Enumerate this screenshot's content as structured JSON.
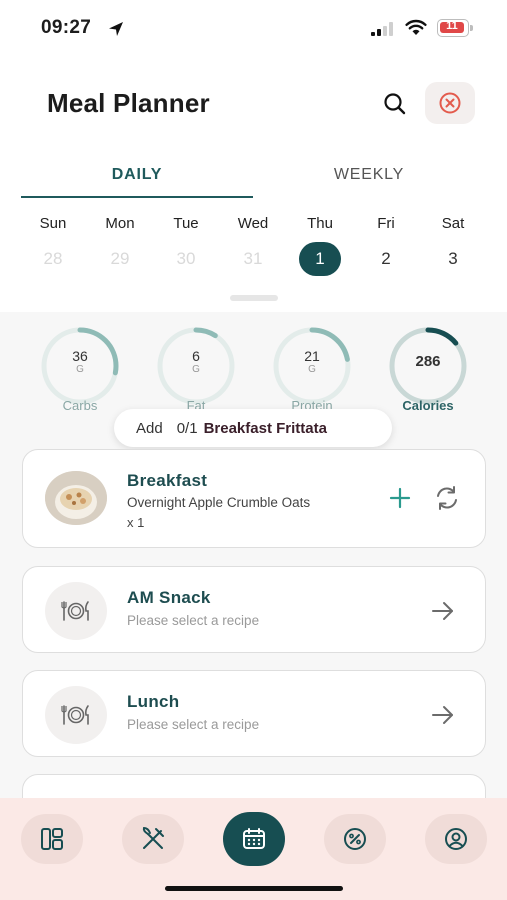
{
  "status_bar": {
    "time": "09:27",
    "battery": "11"
  },
  "header": {
    "title": "Meal Planner"
  },
  "tabs": [
    {
      "label": "DAILY",
      "active": true
    },
    {
      "label": "WEEKLY",
      "active": false
    }
  ],
  "week": [
    {
      "day": "Sun",
      "date": "28",
      "state": "past"
    },
    {
      "day": "Mon",
      "date": "29",
      "state": "past"
    },
    {
      "day": "Tue",
      "date": "30",
      "state": "past"
    },
    {
      "day": "Wed",
      "date": "31",
      "state": "past"
    },
    {
      "day": "Thu",
      "date": "1",
      "state": "selected"
    },
    {
      "day": "Fri",
      "date": "2",
      "state": "future"
    },
    {
      "day": "Sat",
      "date": "3",
      "state": "future"
    }
  ],
  "nutrition": [
    {
      "value": "36",
      "unit": "G",
      "label": "Carbs",
      "progress": 0.28
    },
    {
      "value": "6",
      "unit": "G",
      "label": "Fat",
      "progress": 0.09
    },
    {
      "value": "21",
      "unit": "G",
      "label": "Protein",
      "progress": 0.22
    },
    {
      "value": "286",
      "unit": "",
      "label": "Calories",
      "progress": 0.14
    }
  ],
  "add_pill": {
    "add": "Add",
    "count": "0/1",
    "recipe": "Breakfast Frittata"
  },
  "meals": [
    {
      "name": "Breakfast",
      "recipe": "Overnight Apple Crumble Oats",
      "qty": "x 1"
    },
    {
      "name": "AM Snack",
      "hint": "Please select a recipe"
    },
    {
      "name": "Lunch",
      "hint": "Please select a recipe"
    }
  ],
  "tab_bar": [
    {
      "icon": "dashboard-icon",
      "active": false
    },
    {
      "icon": "fork-knife-icon",
      "active": false
    },
    {
      "icon": "calendar-icon",
      "active": true
    },
    {
      "icon": "percent-badge-icon",
      "active": false
    },
    {
      "icon": "profile-icon",
      "active": false
    }
  ],
  "colors": {
    "primary": "#174e52",
    "accent_teal": "#2b9a8e",
    "ring_track": "#e3ecea",
    "close_red": "#e35b4d",
    "tab_bar_bg": "#fbe9e6"
  }
}
